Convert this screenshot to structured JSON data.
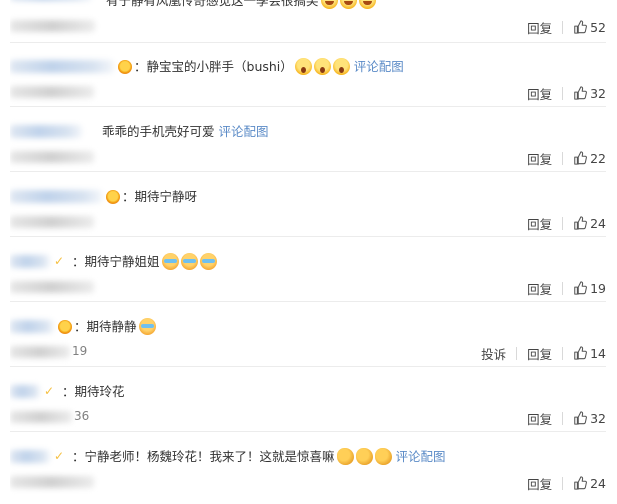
{
  "actions": {
    "reply": "回复",
    "report": "投诉"
  },
  "comments": [
    {
      "text": "有宁静有风凰传奇感觉这一季会很搞笑",
      "likes": "52"
    },
    {
      "text": "静宝宝的小胖手（bushi）",
      "link": "评论配图",
      "likes": "32"
    },
    {
      "text": "乖乖的手机壳好可爱",
      "link": "评论配图",
      "likes": "22"
    },
    {
      "text": "期待宁静呀",
      "likes": "24"
    },
    {
      "text": "期待宁静姐姐",
      "likes": "19"
    },
    {
      "text": "期待静静",
      "meta_partial": "19",
      "likes": "14"
    },
    {
      "text": "期待玲花",
      "meta_partial": "36",
      "likes": "32"
    },
    {
      "text": "宁静老师！杨魏玲花！我来了！这就是惊喜嘛",
      "link": "评论配图",
      "likes": "24"
    }
  ],
  "separator": "：",
  "icons": [
    "thumb-up-icon",
    "emoji-icon",
    "user-badge-icon"
  ]
}
